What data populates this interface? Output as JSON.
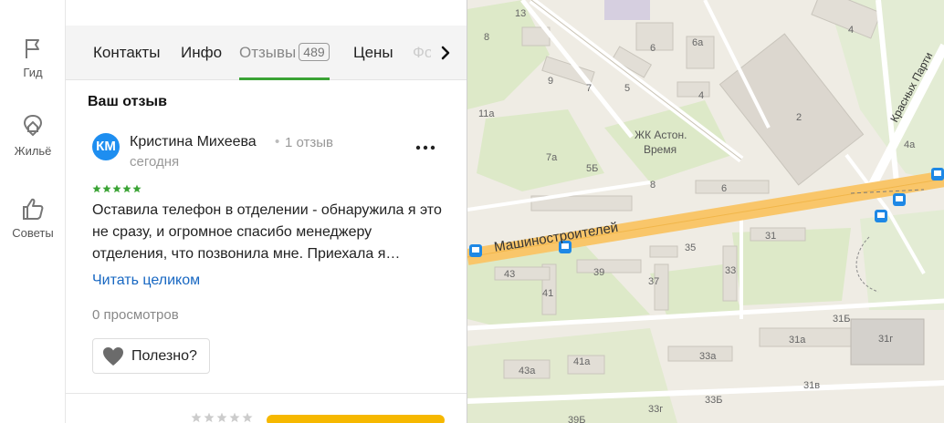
{
  "rail": {
    "items": [
      {
        "label": "Гид",
        "icon": "flag-icon"
      },
      {
        "label": "Жильё",
        "icon": "house-pin-icon"
      },
      {
        "label": "Советы",
        "icon": "thumbs-up-icon"
      }
    ]
  },
  "tabs": {
    "items": [
      {
        "label": "Контакты"
      },
      {
        "label": "Инфо"
      },
      {
        "label": "Отзывы",
        "count": "489",
        "active": true
      },
      {
        "label": "Цены"
      }
    ],
    "fade_label": "Фо"
  },
  "review_section": {
    "title": "Ваш отзыв"
  },
  "review": {
    "avatar_initials": "КМ",
    "author": "Кристина Михеева",
    "separator": "•",
    "reviews_count": "1 отзыв",
    "date": "сегодня",
    "rating": 5,
    "text": "Оставила телефон в отделении - обнаружила я это не сразу, и огромное спасибо менеджеру отделения, что позвонила мне. Приехала я…",
    "read_more": "Читать целиком",
    "views": "0 просмотров",
    "useful_label": "Полезно?"
  },
  "colors": {
    "accent_green": "#3aa335",
    "avatar_blue": "#1e8ef0",
    "link_blue": "#1767c2",
    "star_green": "#3aa335",
    "cta_yellow": "#f6b800"
  },
  "map": {
    "street_label": "Машиностроителей",
    "street_label_2": "Красных Парти",
    "complex_label_1": "ЖК Астон.",
    "complex_label_2": "Время",
    "buildings": [
      "13",
      "8",
      "9",
      "7",
      "5",
      "6",
      "6а",
      "4",
      "4",
      "2",
      "11а",
      "7а",
      "5Б",
      "8",
      "6",
      "4а",
      "35",
      "31",
      "43",
      "39",
      "37",
      "33",
      "41",
      "41а",
      "43а",
      "33а",
      "31а",
      "31г",
      "31Б",
      "31в",
      "33г",
      "33Б",
      "39Б"
    ]
  }
}
